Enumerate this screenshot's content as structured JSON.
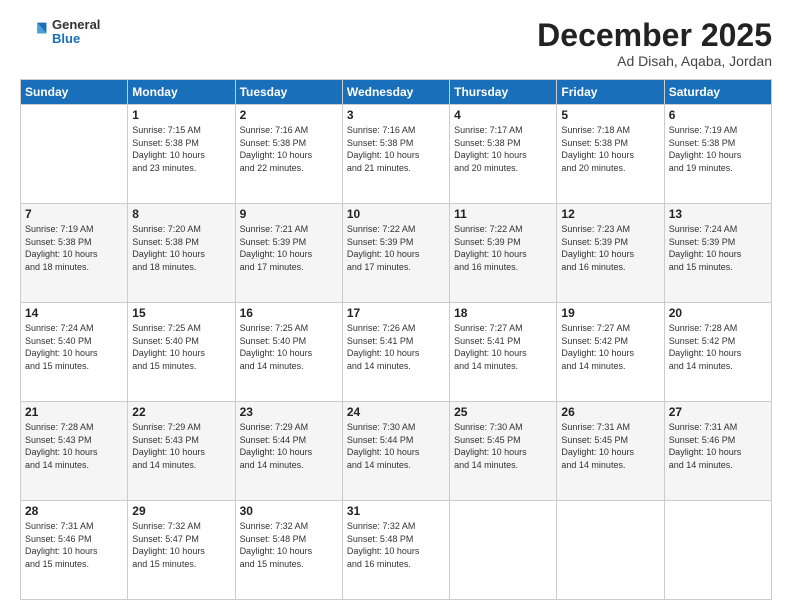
{
  "header": {
    "logo_line1": "General",
    "logo_line2": "Blue",
    "title": "December 2025",
    "subtitle": "Ad Disah, Aqaba, Jordan"
  },
  "days_of_week": [
    "Sunday",
    "Monday",
    "Tuesday",
    "Wednesday",
    "Thursday",
    "Friday",
    "Saturday"
  ],
  "weeks": [
    [
      {
        "day": "",
        "info": ""
      },
      {
        "day": "1",
        "info": "Sunrise: 7:15 AM\nSunset: 5:38 PM\nDaylight: 10 hours\nand 23 minutes."
      },
      {
        "day": "2",
        "info": "Sunrise: 7:16 AM\nSunset: 5:38 PM\nDaylight: 10 hours\nand 22 minutes."
      },
      {
        "day": "3",
        "info": "Sunrise: 7:16 AM\nSunset: 5:38 PM\nDaylight: 10 hours\nand 21 minutes."
      },
      {
        "day": "4",
        "info": "Sunrise: 7:17 AM\nSunset: 5:38 PM\nDaylight: 10 hours\nand 20 minutes."
      },
      {
        "day": "5",
        "info": "Sunrise: 7:18 AM\nSunset: 5:38 PM\nDaylight: 10 hours\nand 20 minutes."
      },
      {
        "day": "6",
        "info": "Sunrise: 7:19 AM\nSunset: 5:38 PM\nDaylight: 10 hours\nand 19 minutes."
      }
    ],
    [
      {
        "day": "7",
        "info": "Sunrise: 7:19 AM\nSunset: 5:38 PM\nDaylight: 10 hours\nand 18 minutes."
      },
      {
        "day": "8",
        "info": "Sunrise: 7:20 AM\nSunset: 5:38 PM\nDaylight: 10 hours\nand 18 minutes."
      },
      {
        "day": "9",
        "info": "Sunrise: 7:21 AM\nSunset: 5:39 PM\nDaylight: 10 hours\nand 17 minutes."
      },
      {
        "day": "10",
        "info": "Sunrise: 7:22 AM\nSunset: 5:39 PM\nDaylight: 10 hours\nand 17 minutes."
      },
      {
        "day": "11",
        "info": "Sunrise: 7:22 AM\nSunset: 5:39 PM\nDaylight: 10 hours\nand 16 minutes."
      },
      {
        "day": "12",
        "info": "Sunrise: 7:23 AM\nSunset: 5:39 PM\nDaylight: 10 hours\nand 16 minutes."
      },
      {
        "day": "13",
        "info": "Sunrise: 7:24 AM\nSunset: 5:39 PM\nDaylight: 10 hours\nand 15 minutes."
      }
    ],
    [
      {
        "day": "14",
        "info": "Sunrise: 7:24 AM\nSunset: 5:40 PM\nDaylight: 10 hours\nand 15 minutes."
      },
      {
        "day": "15",
        "info": "Sunrise: 7:25 AM\nSunset: 5:40 PM\nDaylight: 10 hours\nand 15 minutes."
      },
      {
        "day": "16",
        "info": "Sunrise: 7:25 AM\nSunset: 5:40 PM\nDaylight: 10 hours\nand 14 minutes."
      },
      {
        "day": "17",
        "info": "Sunrise: 7:26 AM\nSunset: 5:41 PM\nDaylight: 10 hours\nand 14 minutes."
      },
      {
        "day": "18",
        "info": "Sunrise: 7:27 AM\nSunset: 5:41 PM\nDaylight: 10 hours\nand 14 minutes."
      },
      {
        "day": "19",
        "info": "Sunrise: 7:27 AM\nSunset: 5:42 PM\nDaylight: 10 hours\nand 14 minutes."
      },
      {
        "day": "20",
        "info": "Sunrise: 7:28 AM\nSunset: 5:42 PM\nDaylight: 10 hours\nand 14 minutes."
      }
    ],
    [
      {
        "day": "21",
        "info": "Sunrise: 7:28 AM\nSunset: 5:43 PM\nDaylight: 10 hours\nand 14 minutes."
      },
      {
        "day": "22",
        "info": "Sunrise: 7:29 AM\nSunset: 5:43 PM\nDaylight: 10 hours\nand 14 minutes."
      },
      {
        "day": "23",
        "info": "Sunrise: 7:29 AM\nSunset: 5:44 PM\nDaylight: 10 hours\nand 14 minutes."
      },
      {
        "day": "24",
        "info": "Sunrise: 7:30 AM\nSunset: 5:44 PM\nDaylight: 10 hours\nand 14 minutes."
      },
      {
        "day": "25",
        "info": "Sunrise: 7:30 AM\nSunset: 5:45 PM\nDaylight: 10 hours\nand 14 minutes."
      },
      {
        "day": "26",
        "info": "Sunrise: 7:31 AM\nSunset: 5:45 PM\nDaylight: 10 hours\nand 14 minutes."
      },
      {
        "day": "27",
        "info": "Sunrise: 7:31 AM\nSunset: 5:46 PM\nDaylight: 10 hours\nand 14 minutes."
      }
    ],
    [
      {
        "day": "28",
        "info": "Sunrise: 7:31 AM\nSunset: 5:46 PM\nDaylight: 10 hours\nand 15 minutes."
      },
      {
        "day": "29",
        "info": "Sunrise: 7:32 AM\nSunset: 5:47 PM\nDaylight: 10 hours\nand 15 minutes."
      },
      {
        "day": "30",
        "info": "Sunrise: 7:32 AM\nSunset: 5:48 PM\nDaylight: 10 hours\nand 15 minutes."
      },
      {
        "day": "31",
        "info": "Sunrise: 7:32 AM\nSunset: 5:48 PM\nDaylight: 10 hours\nand 16 minutes."
      },
      {
        "day": "",
        "info": ""
      },
      {
        "day": "",
        "info": ""
      },
      {
        "day": "",
        "info": ""
      }
    ]
  ]
}
